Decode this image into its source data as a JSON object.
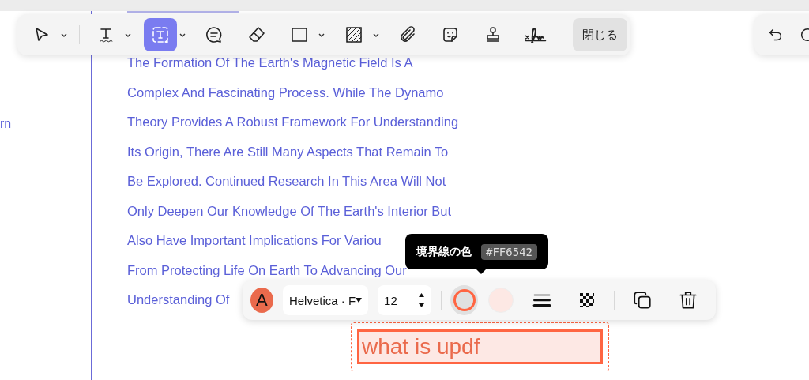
{
  "sidebar_fragments": [
    "rn"
  ],
  "document": {
    "lines": [
      "The Formation Of The Earth's Magnetic Field Is A",
      "Complex And Fascinating Process. While The Dynamo",
      "Theory Provides A Robust Framework For Understanding",
      "Its Origin, There Are Still Many Aspects That Remain To",
      "Be Explored. Continued Research In This Area Will Not",
      "Only Deepen Our Knowledge Of The Earth's Interior But",
      "Also Have Important Implications For Variou",
      "From Protecting Life On Earth To Advancing Our",
      "Understanding Of"
    ]
  },
  "toolbar": {
    "tools": [
      {
        "kind": "select",
        "has_menu": true,
        "selected": false
      },
      {
        "kind": "text",
        "has_menu": true,
        "selected": false
      },
      {
        "kind": "textbox",
        "has_menu": true,
        "selected": true
      },
      {
        "kind": "comment",
        "has_menu": false,
        "selected": false
      },
      {
        "kind": "eraser",
        "has_menu": false,
        "selected": false
      },
      {
        "kind": "rectangle",
        "has_menu": true,
        "selected": false
      },
      {
        "kind": "area",
        "has_menu": true,
        "selected": false
      },
      {
        "kind": "attachment",
        "has_menu": false,
        "selected": false
      },
      {
        "kind": "sticker",
        "has_menu": false,
        "selected": false
      },
      {
        "kind": "stamp",
        "has_menu": false,
        "selected": false
      },
      {
        "kind": "signature",
        "has_menu": false,
        "selected": false
      }
    ],
    "close_button": "閉じる"
  },
  "tooltip": {
    "label": "境界線の色",
    "value": "#FF6542"
  },
  "format_bar": {
    "text_color_label": "A",
    "font": "Helvetica · F",
    "size": "12"
  },
  "text_box": {
    "text": "what is updf"
  }
}
